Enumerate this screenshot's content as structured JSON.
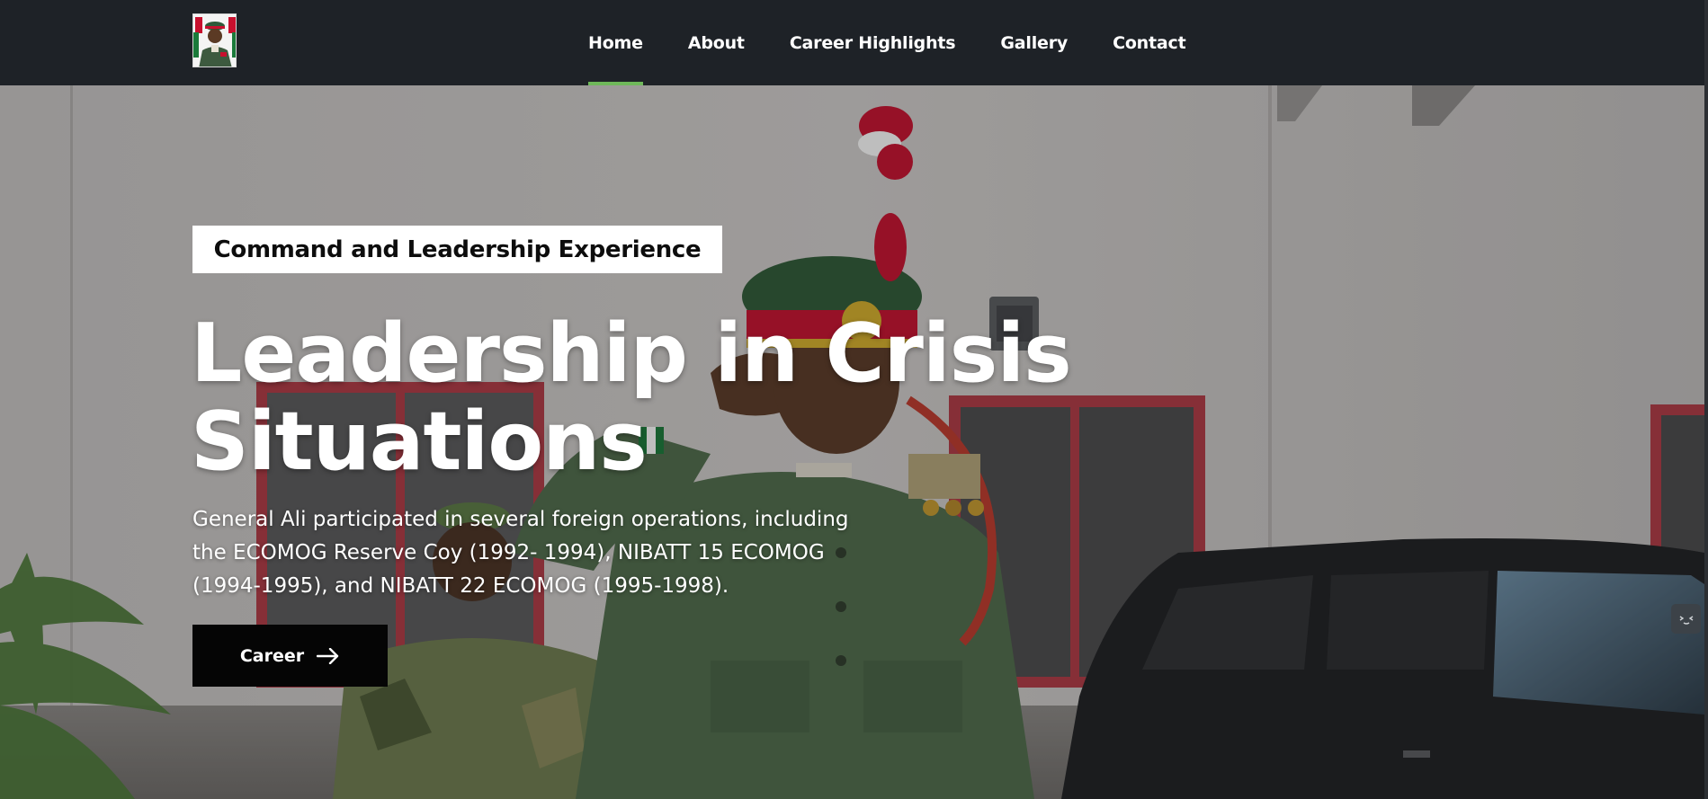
{
  "nav": {
    "logo_alt": "General portrait logo",
    "items": [
      {
        "label": "Home",
        "active": true
      },
      {
        "label": "About",
        "active": false
      },
      {
        "label": "Career Highlights",
        "active": false
      },
      {
        "label": "Gallery",
        "active": false
      },
      {
        "label": "Contact",
        "active": false
      }
    ]
  },
  "hero": {
    "tagline": "Command and Leadership Experience",
    "title_line1": "Leadership in Crisis",
    "title_line2": "Situations",
    "description": "General Ali participated in several foreign operations, including the ECOMOG Reserve Coy (1992- 1994), NIBATT 15 ECOMOG (1994-1995), and NIBATT 22 ECOMOG (1995-1998).",
    "button_label": "Career",
    "button_icon": "arrow-right-icon",
    "side_chip_icon": "chat-widget-icon"
  },
  "colors": {
    "navbar_bg": "#1e2227",
    "active_underline": "#6fb85a",
    "button_bg": "#050505",
    "tagline_bg": "#ffffff"
  }
}
